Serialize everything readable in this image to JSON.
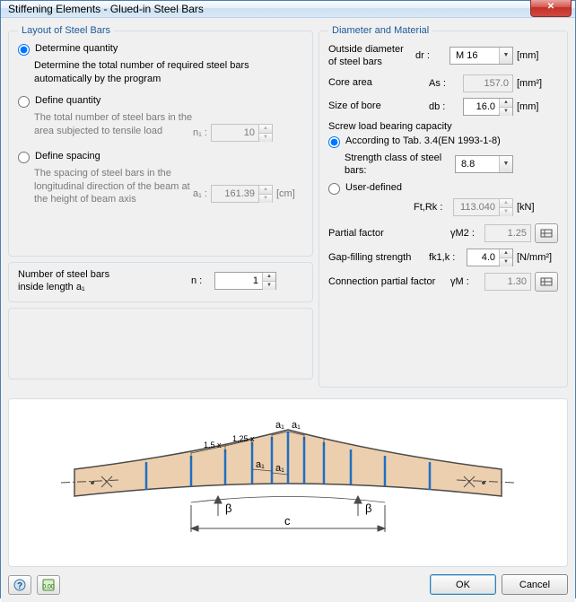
{
  "title": "Stiffening Elements - Glued-in Steel Bars",
  "layout": {
    "legend": "Layout of Steel Bars",
    "opt1": {
      "label": "Determine quantity",
      "desc": "Determine the total number of required steel bars automatically by the program"
    },
    "opt2": {
      "label": "Define quantity",
      "desc": "The total number of steel bars in the area subjected to tensile load",
      "sym": "n₁ :",
      "value": "10",
      "unit": ""
    },
    "opt3": {
      "label": "Define spacing",
      "desc": "The spacing of steel bars in the longitudinal direction of the beam at the height of beam axis",
      "sym": "a₁ :",
      "value": "161.39",
      "unit": "[cm]"
    },
    "num_bars": {
      "label": "Number of steel bars",
      "sub": "inside length a₁",
      "sym": "n :",
      "value": "1"
    }
  },
  "diam": {
    "legend": "Diameter and Material",
    "od": {
      "label": "Outside diameter of steel bars",
      "sym": "dr :",
      "value": "M 16",
      "unit": "[mm]"
    },
    "core": {
      "label": "Core area",
      "sym": "As :",
      "value": "157.0",
      "unit": "[mm²]"
    },
    "bore": {
      "label": "Size of bore",
      "sym": "db :",
      "value": "16.0",
      "unit": "[mm]"
    },
    "screw_head": "Screw load bearing capacity",
    "tab_radio": "According to Tab. 3.4(EN 1993-1-8)",
    "strength_class": {
      "label": "Strength class of steel bars:",
      "value": "8.8"
    },
    "user_radio": "User-defined",
    "ftrk": {
      "sym": "Ft,Rk :",
      "value": "113.040",
      "unit": "[kN]"
    },
    "partial": {
      "label": "Partial factor",
      "sym": "γM2 :",
      "value": "1.25"
    },
    "gap": {
      "label": "Gap-filling strength",
      "sym": "fk1,k :",
      "value": "4.0",
      "unit": "[N/mm²]"
    },
    "conn": {
      "label": "Connection partial factor",
      "sym": "γM :",
      "value": "1.30"
    }
  },
  "diagram": {
    "labels": {
      "a1_top1": "a₁",
      "a1_top2": "a₁",
      "a1_bot1": "a₁",
      "a1_bot2": "a₁",
      "m15": "1,5 x",
      "m125": "1,25 x",
      "beta1": "β",
      "beta2": "β",
      "c": "c"
    }
  },
  "footer": {
    "ok": "OK",
    "cancel": "Cancel"
  }
}
